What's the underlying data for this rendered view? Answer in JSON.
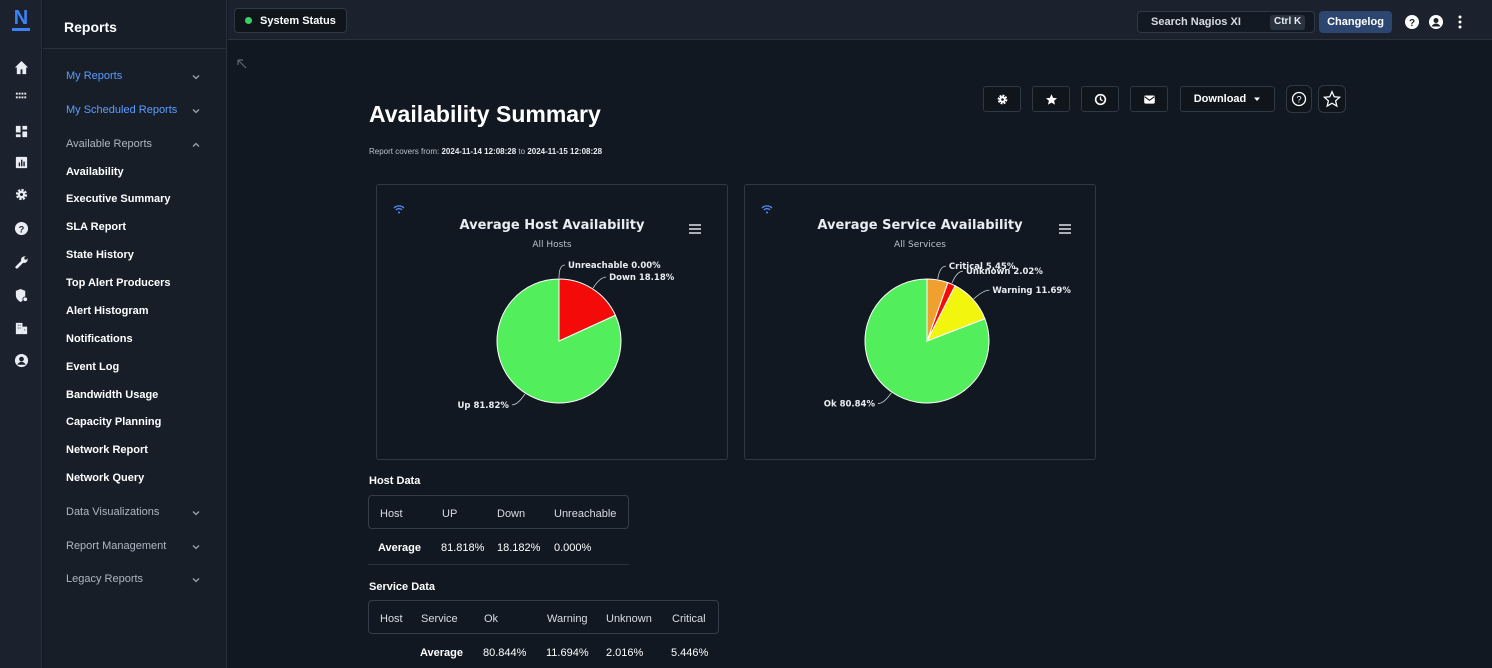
{
  "sidebar": {
    "title": "Reports",
    "groups": {
      "my_reports": "My Reports",
      "my_scheduled": "My Scheduled Reports",
      "available": "Available Reports",
      "data_viz": "Data Visualizations",
      "report_mgmt": "Report Management",
      "legacy": "Legacy Reports"
    },
    "links": [
      "Availability",
      "Executive Summary",
      "SLA Report",
      "State History",
      "Top Alert Producers",
      "Alert Histogram",
      "Notifications",
      "Event Log",
      "Bandwidth Usage",
      "Capacity Planning",
      "Network Report",
      "Network Query"
    ]
  },
  "topbar": {
    "logo": "N",
    "system_status": "System Status",
    "search_placeholder": "Search Nagios XI",
    "search_shortcut": "Ctrl K",
    "changelog": "Changelog"
  },
  "page": {
    "title": "Availability Summary",
    "range_prefix": "Report covers from: ",
    "range_start": "2024-11-14 12:08:28",
    "range_mid": " to ",
    "range_end": "2024-11-15 12:08:28",
    "download_label": "Download"
  },
  "host_chart": {
    "title": "Average Host Availability",
    "subtitle": "All Hosts",
    "colors": [
      "#52ee5c",
      "#f50a0a",
      "#f2a73b"
    ]
  },
  "service_chart": {
    "title": "Average Service Availability",
    "subtitle": "All Services",
    "colors": [
      "#52ee5c",
      "#f2f60f",
      "#f50a0a",
      "#efa02e"
    ]
  },
  "chart_data": [
    {
      "type": "pie",
      "title": "Average Host Availability",
      "subtitle": "All Hosts",
      "slices": [
        {
          "label": "Up",
          "value": 81.82
        },
        {
          "label": "Down",
          "value": 18.18
        },
        {
          "label": "Unreachable",
          "value": 0.0
        }
      ]
    },
    {
      "type": "pie",
      "title": "Average Service Availability",
      "subtitle": "All Services",
      "slices": [
        {
          "label": "Ok",
          "value": 80.84
        },
        {
          "label": "Warning",
          "value": 11.69
        },
        {
          "label": "Unknown",
          "value": 2.02
        },
        {
          "label": "Critical",
          "value": 5.45
        }
      ]
    }
  ],
  "host_data": {
    "title": "Host Data",
    "headers": [
      "Host",
      "UP",
      "Down",
      "Unreachable"
    ],
    "row": [
      "Average",
      "81.818%",
      "18.182%",
      "0.000%"
    ]
  },
  "service_data": {
    "title": "Service Data",
    "headers": [
      "Host",
      "Service",
      "Ok",
      "Warning",
      "Unknown",
      "Critical"
    ],
    "row": [
      "Average",
      "80.844%",
      "11.694%",
      "2.016%",
      "5.446%"
    ]
  }
}
